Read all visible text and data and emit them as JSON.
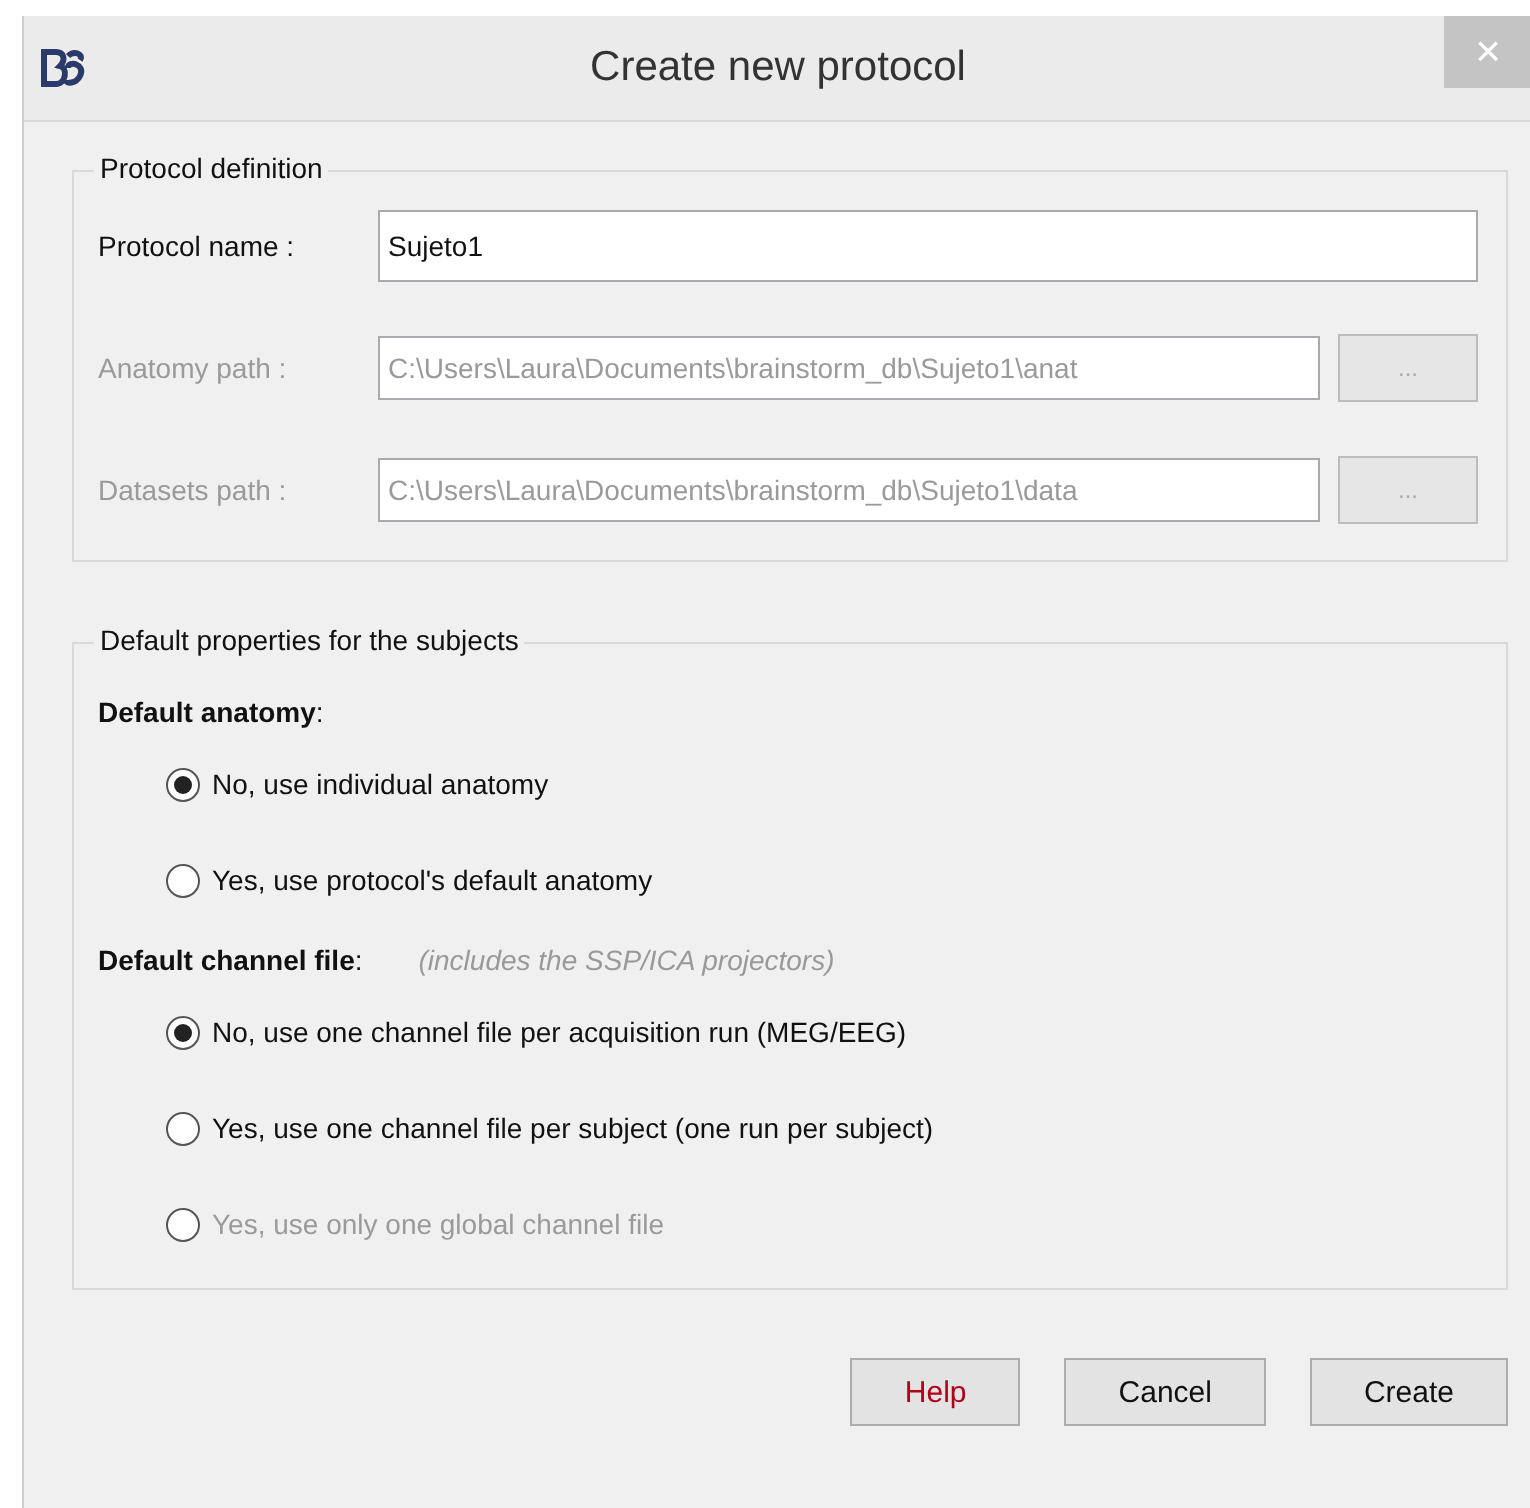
{
  "window": {
    "title": "Create new protocol",
    "close": "×"
  },
  "protocol_definition": {
    "title": "Protocol definition",
    "fields": [
      {
        "label": "Protocol name :",
        "value": "Sujeto1",
        "disabled": false
      },
      {
        "label": "Anatomy path :",
        "value": "C:\\Users\\Laura\\Documents\\brainstorm_db\\Sujeto1\\anat",
        "disabled": true,
        "browse": "..."
      },
      {
        "label": "Datasets path :",
        "value": "C:\\Users\\Laura\\Documents\\brainstorm_db\\Sujeto1\\data",
        "disabled": true,
        "browse": "..."
      }
    ]
  },
  "default_properties": {
    "title": "Default properties for the subjects",
    "sections": [
      {
        "heading": "**Default anatomy**:",
        "options": [
          {
            "label": "No, use individual anatomy",
            "selected": true,
            "disabled": false
          },
          {
            "label": "Yes, use protocol's default anatomy",
            "selected": false,
            "disabled": false
          }
        ]
      },
      {
        "heading": "**Default channel file**:",
        "note": "(includes the SSP/ICA projectors)",
        "options": [
          {
            "label": "No, use one channel file per acquisition run (MEG/EEG)",
            "selected": true,
            "disabled": false
          },
          {
            "label": "Yes, use one channel file per subject  (one run per subject)",
            "selected": false,
            "disabled": false
          },
          {
            "label": "Yes, use only one global channel file",
            "selected": false,
            "disabled": true
          }
        ]
      }
    ]
  },
  "buttons": [
    {
      "label": "Help",
      "kind": "help"
    },
    {
      "label": "Cancel",
      "kind": "normal"
    },
    {
      "label": "Create",
      "kind": "normal"
    }
  ]
}
